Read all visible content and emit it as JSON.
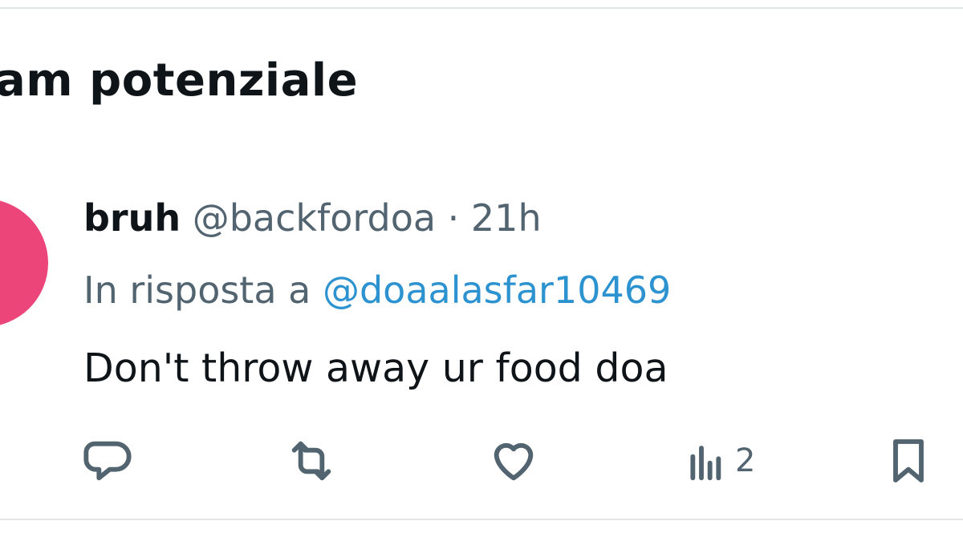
{
  "header": {
    "title": "am potenziale"
  },
  "tweet": {
    "display_name": "bruh",
    "handle": "@backfordoa",
    "separator": "·",
    "time": "21h",
    "reply_prefix": "In risposta a",
    "reply_to": "@doaalasfar10469",
    "text": "Don't throw away ur food doa",
    "avatar_color": "#ec457a"
  },
  "actions": {
    "reply_icon": "reply-icon",
    "retweet_icon": "retweet-icon",
    "like_icon": "heart-icon",
    "views_icon": "views-icon",
    "views_count": "2",
    "bookmark_icon": "bookmark-icon"
  },
  "colors": {
    "text_primary": "#0f1419",
    "text_secondary": "#536471",
    "link": "#2d93d0",
    "divider": "#e1e5e8"
  }
}
